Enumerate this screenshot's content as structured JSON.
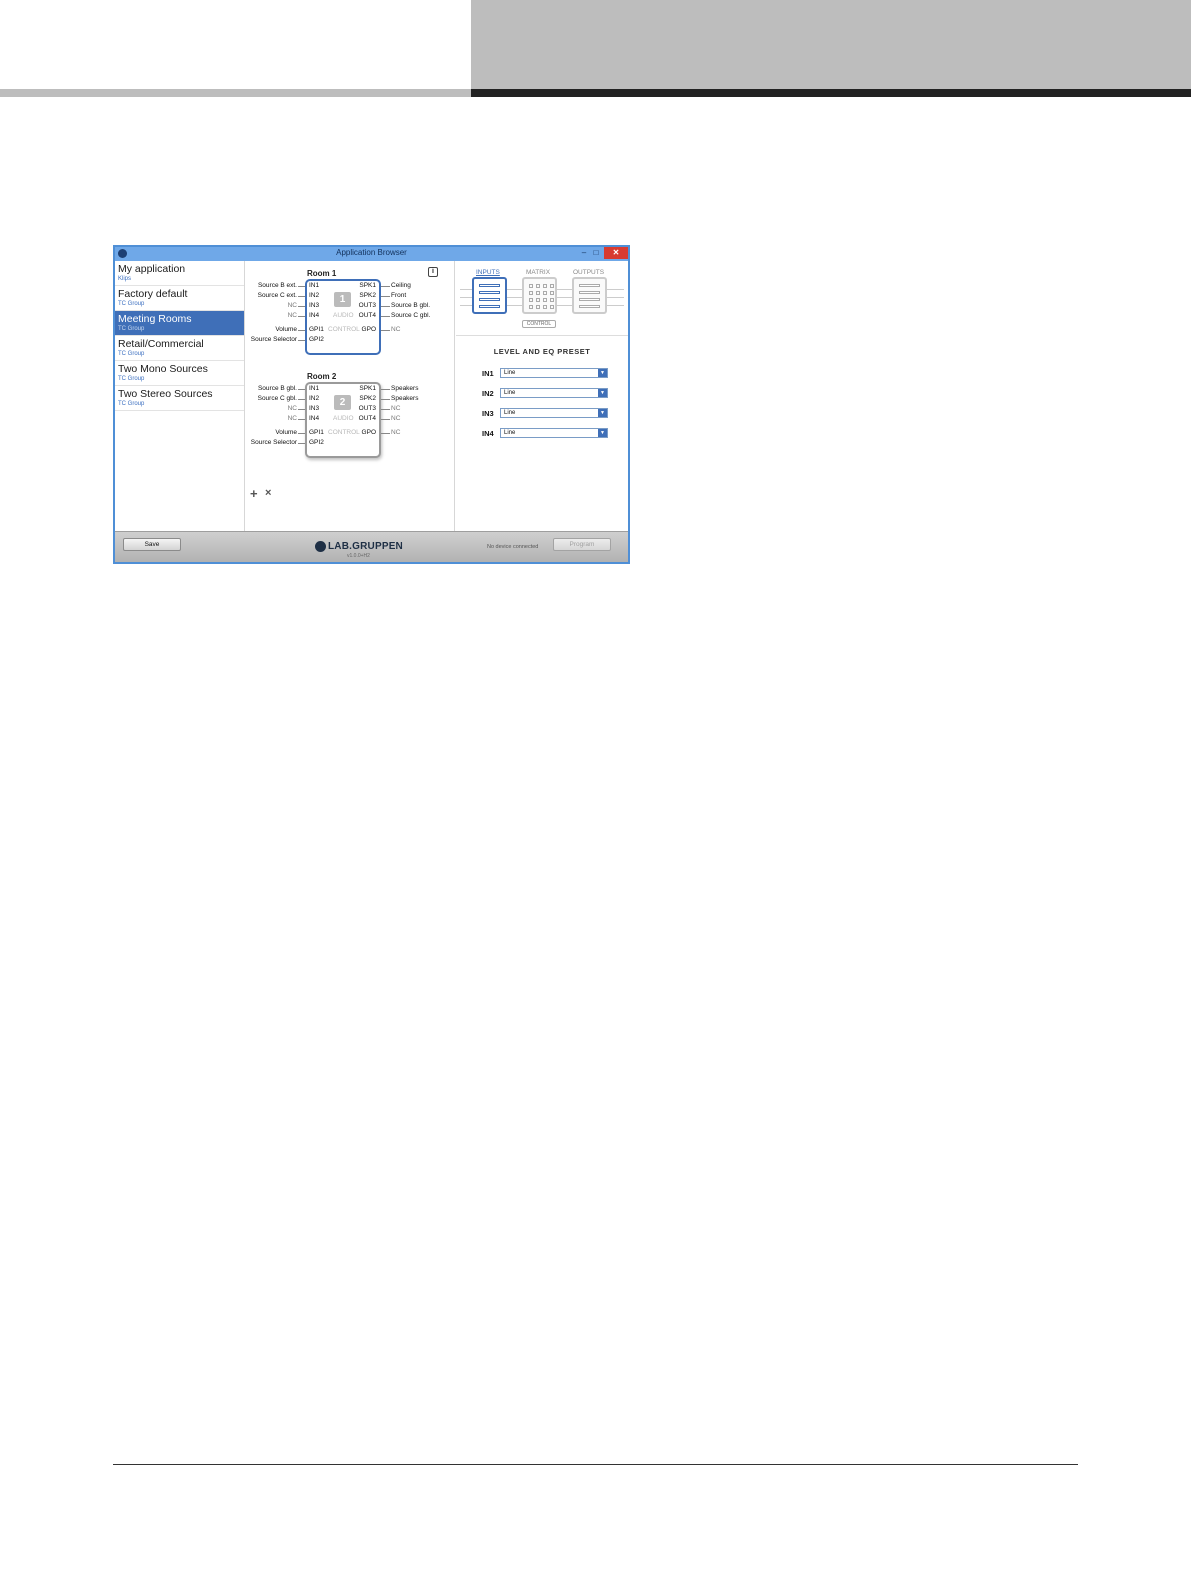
{
  "window": {
    "title": "Application Browser",
    "controls": {
      "minimize": "–",
      "maximize": "□",
      "close": "✕"
    }
  },
  "sidebar": {
    "items": [
      {
        "name": "My application",
        "author": "Klips"
      },
      {
        "name": "Factory default",
        "author": "TC Group"
      },
      {
        "name": "Meeting Rooms",
        "author": "TC Group",
        "selected": true
      },
      {
        "name": "Retail/Commercial",
        "author": "TC Group"
      },
      {
        "name": "Two Mono Sources",
        "author": "TC Group"
      },
      {
        "name": "Two Stereo Sources",
        "author": "TC Group"
      }
    ]
  },
  "rooms": [
    {
      "title": "Room 1",
      "number": "1",
      "inputs": [
        "IN1",
        "IN2",
        "IN3",
        "IN4"
      ],
      "input_labels": [
        "Source B ext.",
        "Source C ext.",
        "NC",
        "NC"
      ],
      "outputs": [
        "SPK1",
        "SPK2",
        "OUT3",
        "OUT4"
      ],
      "output_labels": [
        "Ceiling",
        "Front",
        "Source B gbl.",
        "Source C gbl."
      ],
      "audio_label": "AUDIO",
      "control_label": "CONTROL",
      "gpi": [
        "GPI1",
        "GPI2"
      ],
      "gpi_labels": [
        "Volume",
        "Source Selector"
      ],
      "gpo": "GPO",
      "gpo_label": "NC"
    },
    {
      "title": "Room 2",
      "number": "2",
      "inputs": [
        "IN1",
        "IN2",
        "IN3",
        "IN4"
      ],
      "input_labels": [
        "Source B gbl.",
        "Source C gbl.",
        "NC",
        "NC"
      ],
      "outputs": [
        "SPK1",
        "SPK2",
        "OUT3",
        "OUT4"
      ],
      "output_labels": [
        "Speakers",
        "Speakers",
        "NC",
        "NC"
      ],
      "audio_label": "AUDIO",
      "control_label": "CONTROL",
      "gpi": [
        "GPI1",
        "GPI2"
      ],
      "gpi_labels": [
        "Volume",
        "Source Selector"
      ],
      "gpo": "GPO",
      "gpo_label": "NC"
    }
  ],
  "center": {
    "info": "i",
    "add": "+",
    "remove": "×"
  },
  "flow": {
    "tabs": [
      "INPUTS",
      "MATRIX",
      "OUTPUTS"
    ],
    "active": "INPUTS",
    "control": "CONTROL"
  },
  "preset": {
    "title": "LEVEL AND EQ PRESET",
    "rows": [
      {
        "label": "IN1",
        "value": "Line"
      },
      {
        "label": "IN2",
        "value": "Line"
      },
      {
        "label": "IN3",
        "value": "Line"
      },
      {
        "label": "IN4",
        "value": "Line"
      }
    ]
  },
  "statusbar": {
    "save": "Save",
    "logo": "LAB.GRUPPEN",
    "version": "v1.0.0+H2",
    "status": "No device connected",
    "program": "Program"
  },
  "colors": {
    "accent": "#3f6fb8",
    "titlebar": "#6fa8e8",
    "close": "#d83b30"
  }
}
